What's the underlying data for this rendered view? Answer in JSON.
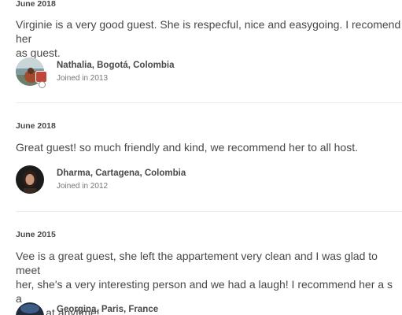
{
  "reviews": [
    {
      "date": "June 2018",
      "text_line1": "Virginie is a very good guest. She is respecful, nice and easygoing. I recomend her",
      "text_line2": "as guest.",
      "reviewer": {
        "name": "Nathalia, Bogotá, Colombia",
        "joined": "Joined in 2013",
        "avatar_icon": "landscape-photo-avatar"
      }
    },
    {
      "date": "June 2018",
      "text_line1": "Great guest! so much friendly and kind, we recommend her to all host.",
      "reviewer": {
        "name": "Dharma, Cartagena, Colombia",
        "joined": "Joined in 2012",
        "avatar_icon": "portrait-photo-avatar"
      }
    },
    {
      "date": "June 2015",
      "text_line1": "Vee is a great guest, she left the appartement very clean and I was glad to meet",
      "text_line2": "her, she's a very interesting person and we had a laugh! I recommend her a s a",
      "text_line3": "guest at anytime!",
      "reviewer": {
        "name": "Georgina, Paris, France",
        "avatar_icon": "photo-avatar"
      }
    }
  ],
  "colors": {
    "text": "#484848",
    "muted": "#767676",
    "divider": "#ebebeb"
  }
}
